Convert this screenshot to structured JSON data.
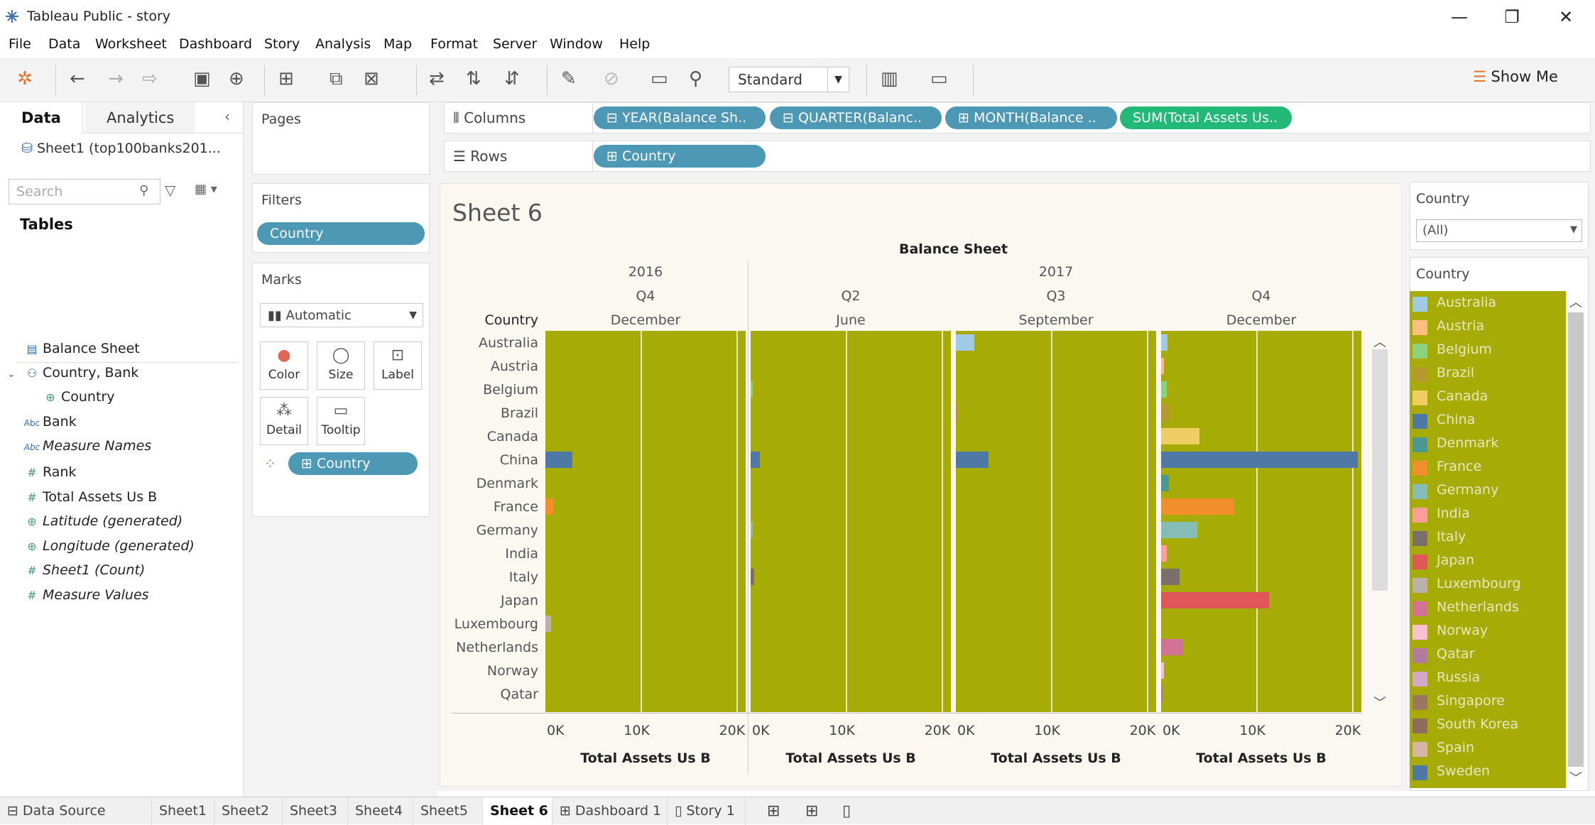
{
  "window": {
    "title": "Tableau Public - story",
    "minimize": "—",
    "restore": "❐",
    "close": "✕"
  },
  "menu": [
    "File",
    "Data",
    "Worksheet",
    "Dashboard",
    "Story",
    "Analysis",
    "Map",
    "Format",
    "Server",
    "Window",
    "Help"
  ],
  "toolbar": {
    "standard": "Standard",
    "show_me": "Show Me"
  },
  "left": {
    "tab_data": "Data",
    "tab_analytics": "Analytics",
    "datasource": "Sheet1 (top100banks201...",
    "search_placeholder": "Search",
    "tables_heading": "Tables",
    "fields": [
      {
        "icon": "calendar-icon",
        "glyph": "▤",
        "label": "Balance Sheet",
        "italic": false
      },
      {
        "icon": "hierarchy-icon",
        "glyph": "⚇",
        "label": "Country, Bank",
        "italic": false
      },
      {
        "icon": "globe-icon",
        "glyph": "⊕",
        "label": "Country",
        "italic": false
      },
      {
        "icon": "abc-icon",
        "glyph": "Abc",
        "label": "Bank",
        "italic": false
      },
      {
        "icon": "abc-icon",
        "glyph": "Abc",
        "label": "Measure Names",
        "italic": true
      },
      {
        "icon": "hash-icon",
        "glyph": "#",
        "label": "Rank",
        "italic": false
      },
      {
        "icon": "hash-icon",
        "glyph": "#",
        "label": "Total Assets Us B",
        "italic": false
      },
      {
        "icon": "globe-icon",
        "glyph": "⊕",
        "label": "Latitude (generated)",
        "italic": true
      },
      {
        "icon": "globe-icon",
        "glyph": "⊕",
        "label": "Longitude (generated)",
        "italic": true
      },
      {
        "icon": "hash-icon",
        "glyph": "#",
        "label": "Sheet1 (Count)",
        "italic": true
      },
      {
        "icon": "hash-icon",
        "glyph": "#",
        "label": "Measure Values",
        "italic": true
      }
    ]
  },
  "cards": {
    "pages": "Pages",
    "filters": "Filters",
    "filter_pill": "Country",
    "marks": "Marks",
    "mark_type": "Automatic",
    "mark_buttons": [
      "Color",
      "Size",
      "Label",
      "Detail",
      "Tooltip"
    ],
    "color_pill": "⊞ Country"
  },
  "shelves": {
    "columns_label": "Columns",
    "rows_label": "Rows",
    "columns": [
      "⊟ YEAR(Balance Sh..",
      "⊟ QUARTER(Balanc..",
      "⊞ MONTH(Balance ..",
      "SUM(Total Assets Us.."
    ],
    "rows": [
      "⊞ Country"
    ]
  },
  "sheet": {
    "title": "Sheet 6",
    "row_header": "Country"
  },
  "chart_data": {
    "type": "bar",
    "orientation": "horizontal",
    "title": "Sheet 6",
    "column_header": "Balance Sheet",
    "years": [
      {
        "label": "2016",
        "span": [
          0
        ]
      },
      {
        "label": "2017",
        "span": [
          1,
          2,
          3
        ]
      }
    ],
    "panels": [
      {
        "quarter": "Q4",
        "month": "December"
      },
      {
        "quarter": "Q2",
        "month": "June"
      },
      {
        "quarter": "Q3",
        "month": "September"
      },
      {
        "quarter": "Q4",
        "month": "December"
      }
    ],
    "categories": [
      "Australia",
      "Austria",
      "Belgium",
      "Brazil",
      "Canada",
      "China",
      "Denmark",
      "France",
      "Germany",
      "India",
      "Italy",
      "Japan",
      "Luxembourg",
      "Netherlands",
      "Norway",
      "Qatar"
    ],
    "series": [
      {
        "values": [
          0,
          0,
          0,
          0,
          0,
          2800,
          0,
          800,
          0,
          0,
          0,
          0,
          600,
          0,
          0,
          0
        ]
      },
      {
        "values": [
          0,
          0,
          100,
          0,
          0,
          1000,
          0,
          0,
          100,
          0,
          400,
          0,
          0,
          0,
          0,
          0
        ]
      },
      {
        "values": [
          1900,
          0,
          0,
          100,
          0,
          3400,
          0,
          0,
          0,
          0,
          0,
          0,
          0,
          0,
          0,
          0
        ]
      },
      {
        "values": [
          700,
          300,
          600,
          1000,
          4000,
          20600,
          800,
          7700,
          3800,
          600,
          1900,
          11300,
          0,
          2300,
          300,
          200
        ]
      }
    ],
    "xlabel": "Total Assets Us B",
    "xticks": [
      "0K",
      "10K",
      "20K"
    ],
    "xlim": [
      0,
      21000
    ],
    "background": "#a6ab05"
  },
  "right": {
    "filter_title": "Country",
    "filter_value": "(All)",
    "legend_title": "Country",
    "legend": [
      {
        "name": "Australia",
        "color": "#a0cbe8"
      },
      {
        "name": "Austria",
        "color": "#ffbe7d"
      },
      {
        "name": "Belgium",
        "color": "#8cd17d"
      },
      {
        "name": "Brazil",
        "color": "#b6992d"
      },
      {
        "name": "Canada",
        "color": "#f1ce63"
      },
      {
        "name": "China",
        "color": "#4e79a7"
      },
      {
        "name": "Denmark",
        "color": "#499894"
      },
      {
        "name": "France",
        "color": "#f28e2b"
      },
      {
        "name": "Germany",
        "color": "#86bcb6"
      },
      {
        "name": "India",
        "color": "#ff9d9a"
      },
      {
        "name": "Italy",
        "color": "#79706e"
      },
      {
        "name": "Japan",
        "color": "#e15759"
      },
      {
        "name": "Luxembourg",
        "color": "#bab0ac"
      },
      {
        "name": "Netherlands",
        "color": "#d37295"
      },
      {
        "name": "Norway",
        "color": "#fabfd2"
      },
      {
        "name": "Qatar",
        "color": "#b07aa1"
      },
      {
        "name": "Russia",
        "color": "#d4a6c8"
      },
      {
        "name": "Singapore",
        "color": "#9d7660"
      },
      {
        "name": "South Korea",
        "color": "#8f6b5e"
      },
      {
        "name": "Spain",
        "color": "#d7b5a6"
      },
      {
        "name": "Sweden",
        "color": "#4e79a7"
      }
    ]
  },
  "bottom_tabs": [
    "Data Source",
    "Sheet1",
    "Sheet2",
    "Sheet3",
    "Sheet4",
    "Sheet5",
    "Sheet 6",
    "Dashboard 1",
    "Story 1"
  ],
  "bottom_tab_icons": [
    "⊟",
    "",
    "",
    "",
    "",
    "",
    "",
    "⊞",
    "▯"
  ]
}
